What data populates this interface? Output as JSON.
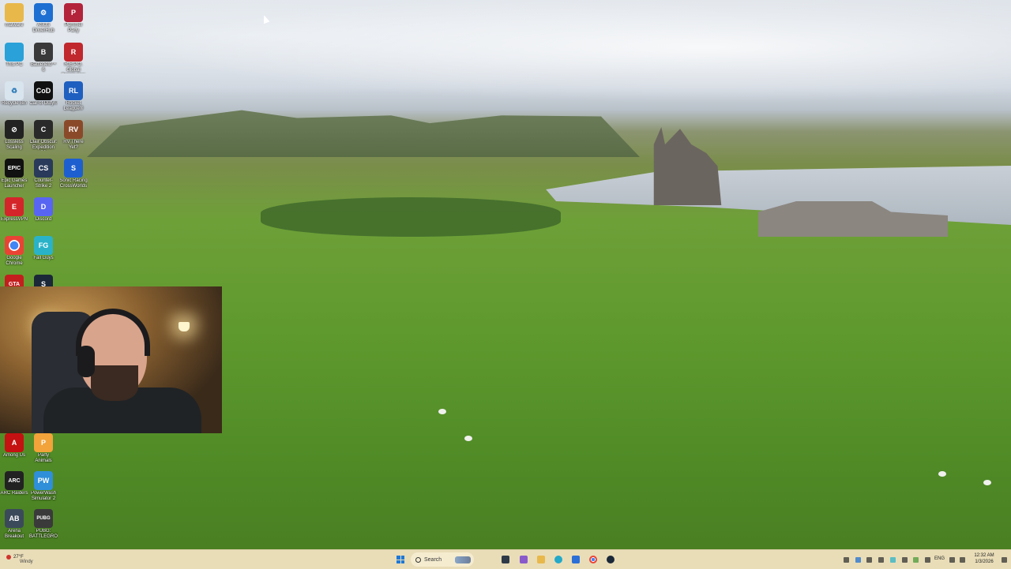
{
  "desktop_icons": [
    {
      "label": "malware",
      "color": "#e8b84a",
      "glyph": "📁"
    },
    {
      "label": "ASUS DriverHub",
      "color": "#1d6fd1",
      "glyph": "⚙"
    },
    {
      "label": "Pummel Party",
      "color": "#b3233a",
      "glyph": "P"
    },
    {
      "label": "This PC",
      "color": "#2aa1d8",
      "glyph": "▭"
    },
    {
      "label": "Battlefield™ 6",
      "color": "#3a3a3a",
      "glyph": "B"
    },
    {
      "label": "R.E.P.O. Global Distribution",
      "color": "#c0282d",
      "glyph": "R"
    },
    {
      "label": "Recycle Bin",
      "color": "#d8e4ee",
      "glyph": "♻"
    },
    {
      "label": "Call of Duty®",
      "color": "#111111",
      "glyph": "CoD"
    },
    {
      "label": "Rocket League®",
      "color": "#1f5fbf",
      "glyph": "RL"
    },
    {
      "label": "Lossless Scaling",
      "color": "#222222",
      "glyph": "⊘"
    },
    {
      "label": "Clair Obscur: Expedition 33",
      "color": "#2a2a2a",
      "glyph": "C"
    },
    {
      "label": "RV There Yet?",
      "color": "#8a4a2a",
      "glyph": "RV"
    },
    {
      "label": "Epic Games Launcher",
      "color": "#111111",
      "glyph": "EPIC"
    },
    {
      "label": "Counter-Strike 2",
      "color": "#2a3a5a",
      "glyph": "CS"
    },
    {
      "label": "Sonic Racing CrossWorlds",
      "color": "#1e5fd0",
      "glyph": "S"
    },
    {
      "label": "ExpressVPN",
      "color": "#d4252b",
      "glyph": "E"
    },
    {
      "label": "Discord",
      "color": "#5865f2",
      "glyph": "D"
    },
    {
      "label": "Google Chrome",
      "color": "#ffffff",
      "glyph": "◉"
    },
    {
      "label": "Fall Guys",
      "color": "#2ab3c8",
      "glyph": "FG"
    },
    {
      "label": "GTA",
      "color": "#c41e1e",
      "glyph": "GTA"
    },
    {
      "label": "Steam",
      "color": "#1b2838",
      "glyph": "S"
    },
    {
      "label": "Among Us",
      "color": "#c51111",
      "glyph": "A"
    },
    {
      "label": "Party Animals",
      "color": "#f2a33a",
      "glyph": "P"
    },
    {
      "label": "ARC Raiders",
      "color": "#222222",
      "glyph": "ARC"
    },
    {
      "label": "PowerWash Simulator 2",
      "color": "#2f8fd8",
      "glyph": "PW"
    },
    {
      "label": "Arena Breakout",
      "color": "#3b4a5a",
      "glyph": "AB"
    },
    {
      "label": "PUBG: BATTLEGROUNDS",
      "color": "#3a3a3a",
      "glyph": "PUBG"
    }
  ],
  "taskbar": {
    "weather": {
      "temp": "27°F",
      "desc": "Windy"
    },
    "search_label": "Search",
    "clock": {
      "time": "12:32 AM",
      "date": "1/3/2026"
    },
    "language": "ENG"
  }
}
